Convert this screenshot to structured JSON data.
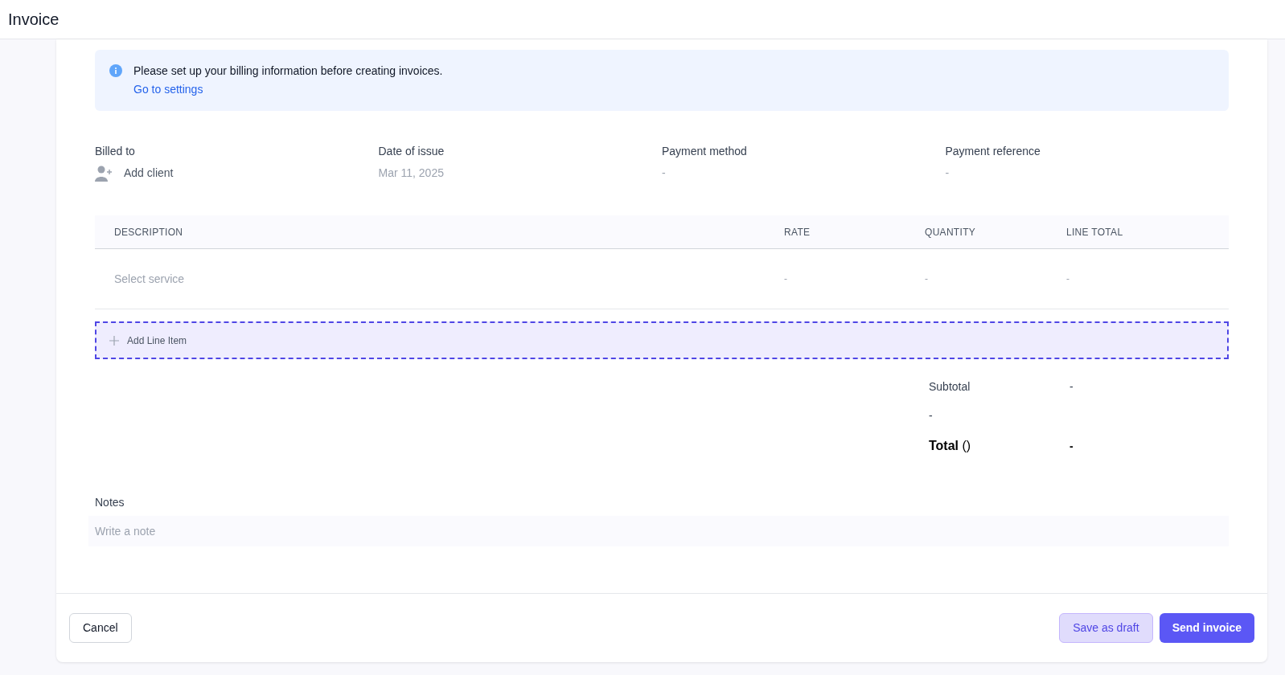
{
  "header": {
    "title": "Invoice"
  },
  "alert": {
    "message": "Please set up your billing information before creating invoices.",
    "link": "Go to settings"
  },
  "details": [
    {
      "kind": "client",
      "label": "Billed to",
      "value": "Add client"
    },
    {
      "kind": "text",
      "label": "Date of issue",
      "value": "Mar 11, 2025"
    },
    {
      "kind": "text",
      "label": "Payment method",
      "value": "-"
    },
    {
      "kind": "text",
      "label": "Payment reference",
      "value": "-"
    }
  ],
  "table": {
    "columns": [
      "DESCRIPTION",
      "RATE",
      "QUANTITY",
      "LINE TOTAL"
    ],
    "rows": [
      {
        "placeholder": "Select service",
        "rate": "-",
        "quantity": "-",
        "line_total": "-"
      }
    ]
  },
  "add_line_item": "Add Line Item",
  "totals": [
    {
      "kind": "subtotal",
      "label": "Subtotal",
      "value": "-"
    },
    {
      "kind": "tax",
      "label": "-"
    },
    {
      "kind": "total",
      "label": "**Total** ()",
      "value": "-"
    }
  ],
  "notes": {
    "label": "Notes",
    "placeholder": "Write a note"
  },
  "buttons": {
    "cancel": "Cancel",
    "draft": "Save as draft",
    "send": "Send invoice"
  }
}
